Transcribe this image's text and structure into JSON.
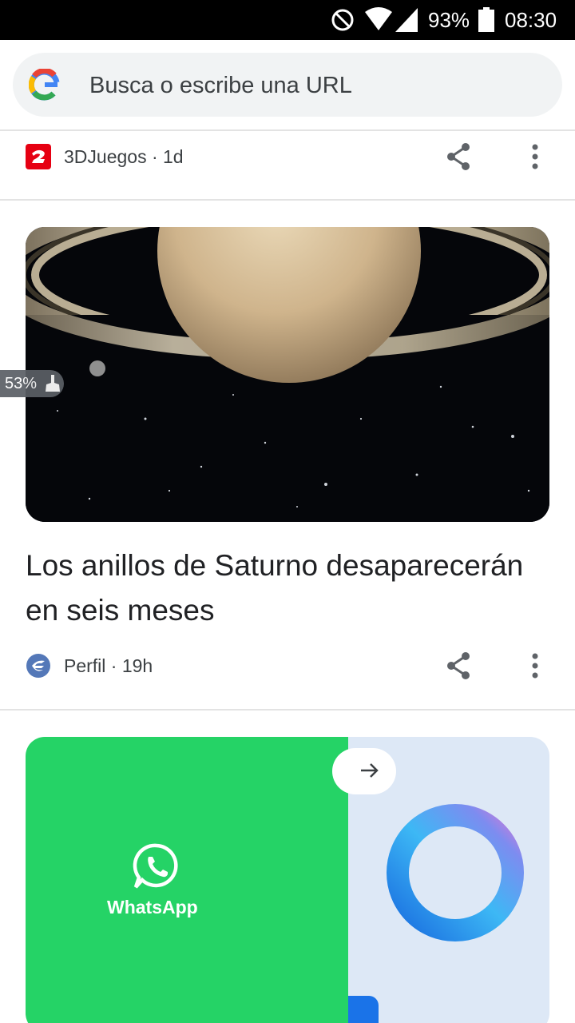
{
  "status_bar": {
    "battery_percent": "93%",
    "time": "08:30",
    "icons": [
      "do-not-disturb-icon",
      "wifi-icon",
      "signal-icon",
      "battery-icon"
    ]
  },
  "search": {
    "placeholder": "Busca o escribe una URL",
    "logo": "google-g-logo"
  },
  "feed": [
    {
      "source": "3DJuegos · 1d",
      "source_icon": "3djuegos-logo",
      "actions": [
        "share-icon",
        "more-vert-icon"
      ]
    },
    {
      "image": "saturn-rings-image",
      "headline": "Los anillos de Saturno desaparecerán en seis meses",
      "source": "Perfil · 19h",
      "source_icon": "perfil-logo",
      "actions": [
        "share-icon",
        "more-vert-icon"
      ]
    },
    {
      "image": "whatsapp-cortana-image",
      "image_text": "WhatsApp"
    }
  ],
  "floating_widget": {
    "text": "53%",
    "icon": "broom-icon"
  },
  "colors": {
    "whatsapp_green": "#25d366",
    "search_bg": "#f1f3f4",
    "accent_blue": "#1a73e8",
    "3djuegos_red": "#e60012"
  }
}
